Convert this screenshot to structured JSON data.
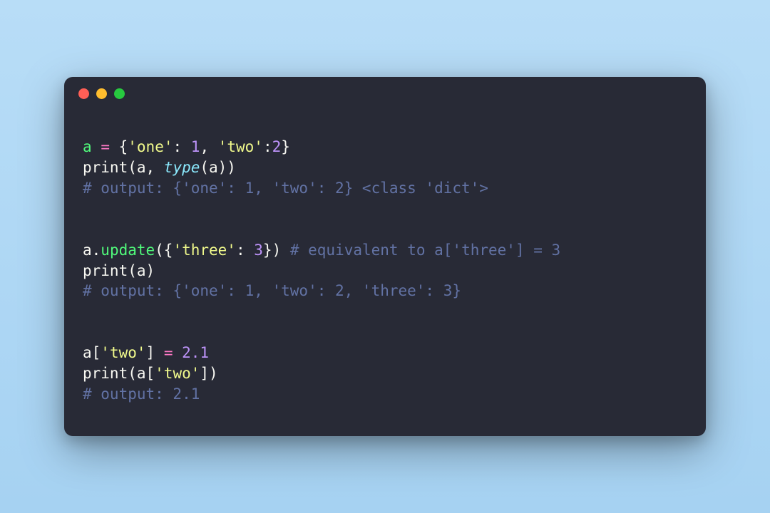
{
  "window": {
    "dots": [
      "red",
      "yellow",
      "green"
    ]
  },
  "code": {
    "lines": [
      [
        {
          "t": "a",
          "c": "tok-var"
        },
        {
          "t": " ",
          "c": "tok-default"
        },
        {
          "t": "=",
          "c": "tok-op"
        },
        {
          "t": " {",
          "c": "tok-default"
        },
        {
          "t": "'one'",
          "c": "tok-string"
        },
        {
          "t": ": ",
          "c": "tok-default"
        },
        {
          "t": "1",
          "c": "tok-number"
        },
        {
          "t": ", ",
          "c": "tok-default"
        },
        {
          "t": "'two'",
          "c": "tok-string"
        },
        {
          "t": ":",
          "c": "tok-default"
        },
        {
          "t": "2",
          "c": "tok-number"
        },
        {
          "t": "}",
          "c": "tok-default"
        }
      ],
      [
        {
          "t": "print",
          "c": "tok-call"
        },
        {
          "t": "(a, ",
          "c": "tok-default"
        },
        {
          "t": "type",
          "c": "tok-builtin"
        },
        {
          "t": "(a))",
          "c": "tok-default"
        }
      ],
      [
        {
          "t": "# output: {'one': 1, 'two': 2} <class 'dict'>",
          "c": "tok-comment"
        }
      ],
      [],
      [],
      [
        {
          "t": "a.",
          "c": "tok-default"
        },
        {
          "t": "update",
          "c": "tok-method"
        },
        {
          "t": "({",
          "c": "tok-default"
        },
        {
          "t": "'three'",
          "c": "tok-string"
        },
        {
          "t": ": ",
          "c": "tok-default"
        },
        {
          "t": "3",
          "c": "tok-number"
        },
        {
          "t": "}) ",
          "c": "tok-default"
        },
        {
          "t": "# equivalent to a['three'] = 3",
          "c": "tok-comment"
        }
      ],
      [
        {
          "t": "print",
          "c": "tok-call"
        },
        {
          "t": "(a)",
          "c": "tok-default"
        }
      ],
      [
        {
          "t": "# output: {'one': 1, 'two': 2, 'three': 3}",
          "c": "tok-comment"
        }
      ],
      [],
      [],
      [
        {
          "t": "a[",
          "c": "tok-default"
        },
        {
          "t": "'two'",
          "c": "tok-string"
        },
        {
          "t": "] ",
          "c": "tok-default"
        },
        {
          "t": "=",
          "c": "tok-op"
        },
        {
          "t": " ",
          "c": "tok-default"
        },
        {
          "t": "2.1",
          "c": "tok-number"
        }
      ],
      [
        {
          "t": "print",
          "c": "tok-call"
        },
        {
          "t": "(a[",
          "c": "tok-default"
        },
        {
          "t": "'two'",
          "c": "tok-string"
        },
        {
          "t": "])",
          "c": "tok-default"
        }
      ],
      [
        {
          "t": "# output: 2.1",
          "c": "tok-comment"
        }
      ]
    ]
  }
}
